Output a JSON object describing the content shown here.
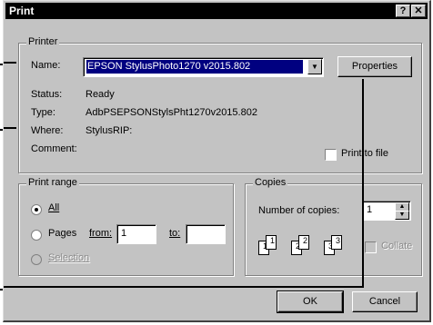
{
  "window": {
    "title": "Print",
    "help_label": "?",
    "close_label": "✕"
  },
  "printer": {
    "group_label": "Printer",
    "name_label": "Name:",
    "name_value": "EPSON StylusPhoto1270 v2015.802",
    "properties_label": "Properties",
    "status_label": "Status:",
    "status_value": "Ready",
    "type_label": "Type:",
    "type_value": "AdbPSEPSONStylsPht1270v2015.802",
    "where_label": "Where:",
    "where_value": "StylusRIP:",
    "comment_label": "Comment:",
    "comment_value": "",
    "print_to_file_label": "Print to file"
  },
  "print_range": {
    "group_label": "Print range",
    "all_label": "All",
    "pages_label": "Pages",
    "from_label": "from:",
    "from_value": "1",
    "to_label": "to:",
    "to_value": "",
    "selection_label": "Selection",
    "selected": "All"
  },
  "copies": {
    "group_label": "Copies",
    "number_label": "Number of copies:",
    "number_value": "1",
    "collate_label": "Collate",
    "page_numbers": [
      "1",
      "1",
      "2",
      "2",
      "3",
      "3"
    ]
  },
  "buttons": {
    "ok_label": "OK",
    "cancel_label": "Cancel"
  },
  "icons": {
    "dropdown": "chevron-down-icon",
    "spin_up": "spin-up-icon",
    "spin_down": "spin-down-icon"
  }
}
